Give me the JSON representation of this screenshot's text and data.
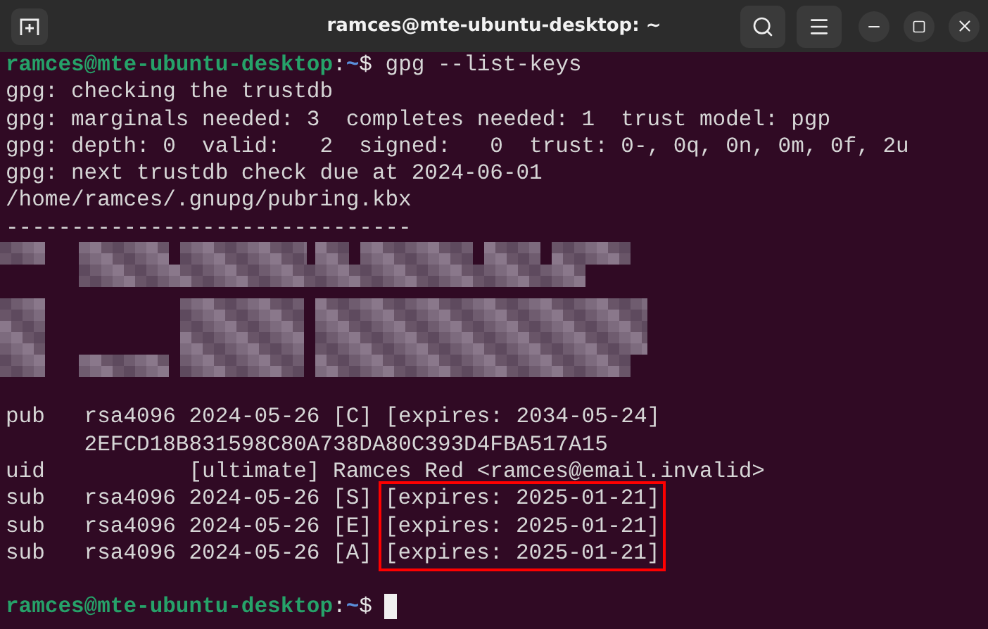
{
  "window": {
    "title": "ramces@mte-ubuntu-desktop: ~"
  },
  "command_prompt": {
    "user": "ramces@mte-ubuntu-desktop",
    "sep": ":",
    "path": "~",
    "symbol": "$",
    "command": "gpg --list-keys"
  },
  "output_lines": [
    "gpg: checking the trustdb",
    "gpg: marginals needed: 3  completes needed: 1  trust model: pgp",
    "gpg: depth: 0  valid:   2  signed:   0  trust: 0-, 0q, 0n, 0m, 0f, 2u",
    "gpg: next trustdb check due at 2024-06-01",
    "/home/ramces/.gnupg/pubring.kbx",
    "-------------------------------"
  ],
  "redaction": {
    "kind": "pixelated"
  },
  "key_lines": [
    {
      "text": "pub   rsa4096 2024-05-26 [C] [expires: 2034-05-24]"
    },
    {
      "text": "      2EFCD18B831598C80A738DA80C393D4FBA517A15"
    },
    {
      "text": "uid           [ultimate] Ramces Red <ramces@email.invalid>"
    },
    {
      "text": "sub   rsa4096 2024-05-26 [S]",
      "expires": "[expires: 2025-01-21]",
      "highlighted": true
    },
    {
      "text": "sub   rsa4096 2024-05-26 [E]",
      "expires": "[expires: 2025-01-21]",
      "highlighted": true
    },
    {
      "text": "sub   rsa4096 2024-05-26 [A]",
      "expires": "[expires: 2025-01-21]",
      "highlighted": true
    }
  ],
  "final_prompt": {
    "user": "ramces@mte-ubuntu-desktop",
    "sep": ":",
    "path": "~",
    "symbol": "$"
  }
}
